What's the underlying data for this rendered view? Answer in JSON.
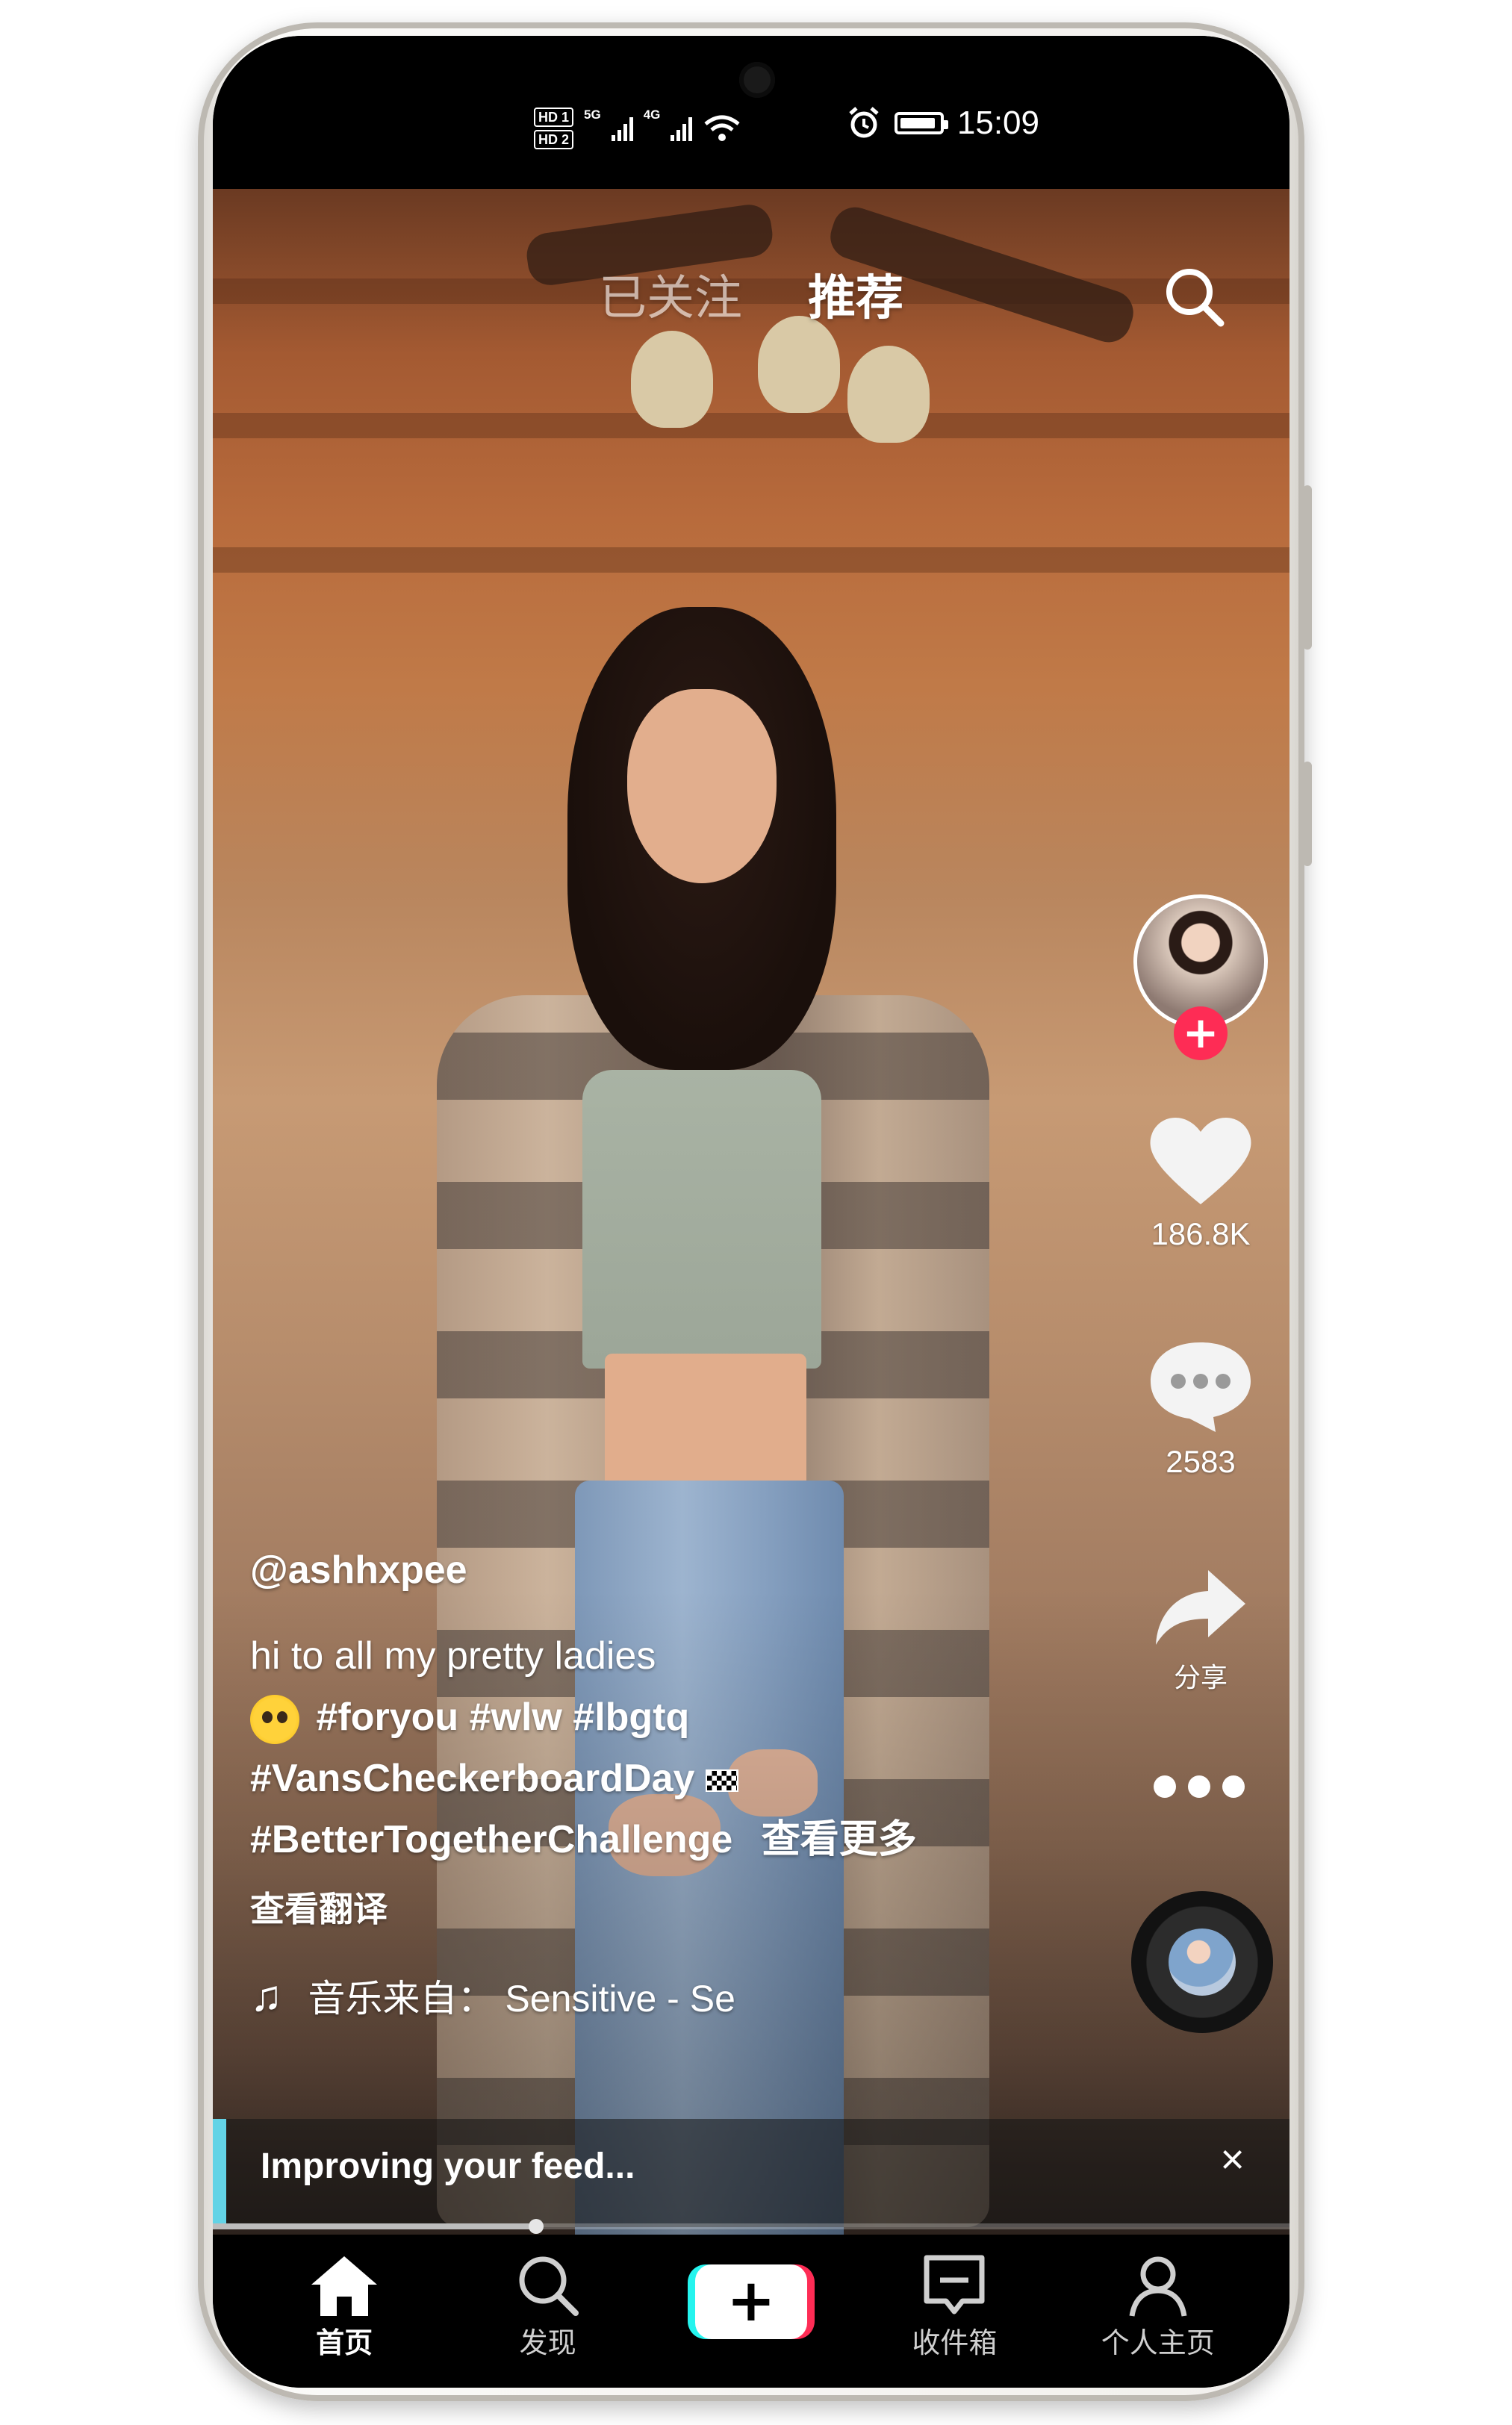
{
  "status_bar": {
    "hd1": "HD 1",
    "hd2": "HD 2",
    "net1": "5G",
    "net2": "4G",
    "time": "15:09"
  },
  "top_tabs": {
    "following": "已关注",
    "for_you": "推荐"
  },
  "icons": {
    "search": "search-icon",
    "heart": "heart-icon",
    "comment": "comment-icon",
    "share": "share-icon",
    "music": "music-note-icon",
    "home": "home-icon",
    "discover": "discover-icon",
    "inbox": "inbox-icon",
    "profile": "profile-icon"
  },
  "rail": {
    "likes": "186.8K",
    "comments": "2583",
    "share_label": "分享"
  },
  "caption": {
    "username": "@ashhxpee",
    "line1": "hi to all my pretty ladies",
    "line2_tags": "#foryou #wlw #lbgtq",
    "line3_tag": "#VansCheckerboardDay",
    "line4_tag": "#BetterTogetherChallenge",
    "see_more": "查看更多",
    "translate": "查看翻译",
    "music_prefix": "音乐来自：",
    "music_title": "Sensitive - Se"
  },
  "feed_bar": {
    "text": "Improving your feed...",
    "close": "×",
    "progress": 0.3
  },
  "nav": {
    "home": "首页",
    "discover": "发现",
    "create": "+",
    "inbox": "收件箱",
    "profile": "个人主页"
  },
  "colors": {
    "accent_red": "#fe2c55",
    "accent_cyan": "#25f4ee"
  }
}
